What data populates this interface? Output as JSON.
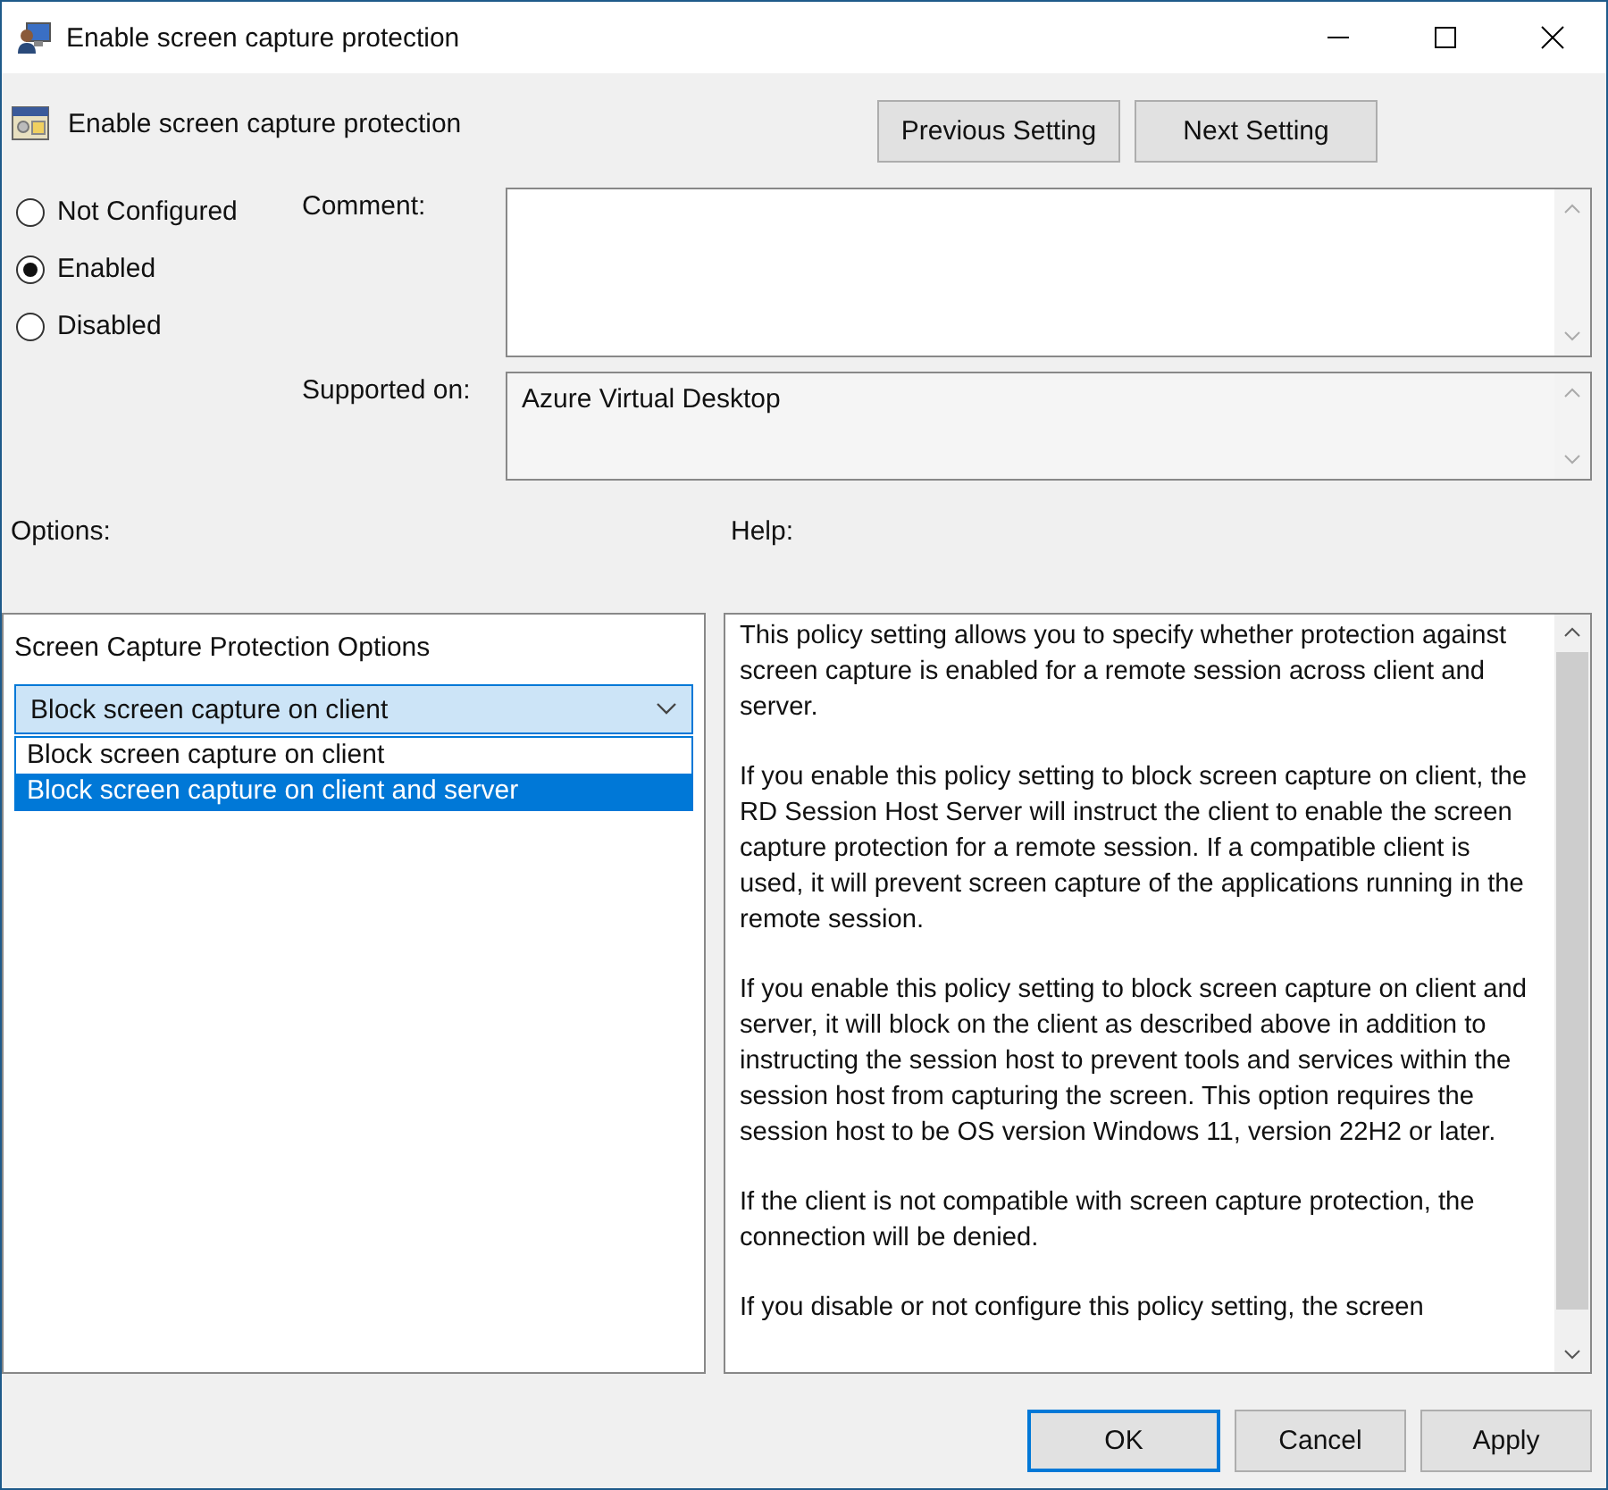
{
  "window": {
    "title": "Enable screen capture protection"
  },
  "setting": {
    "title": "Enable screen capture protection"
  },
  "nav_buttons": [
    "Previous Setting",
    "Next Setting"
  ],
  "state_options": [
    {
      "label": "Not Configured",
      "selected": false
    },
    {
      "label": "Enabled",
      "selected": true
    },
    {
      "label": "Disabled",
      "selected": false
    }
  ],
  "comment": {
    "label": "Comment:"
  },
  "supported_on": {
    "label": "Supported on:",
    "value": "Azure Virtual Desktop"
  },
  "options": {
    "label": "Options:",
    "group_label": "Screen Capture Protection Options",
    "dropdown": {
      "value": "Block screen capture on client",
      "expanded": true,
      "items": [
        {
          "label": "Block screen capture on client",
          "highlighted": false
        },
        {
          "label": "Block screen capture on client and server",
          "highlighted": true
        }
      ]
    }
  },
  "help": {
    "label": "Help:",
    "paragraphs": [
      "This policy setting allows you to specify whether protection against screen capture is enabled for a remote session across client and server.",
      "If you enable this policy setting to block screen capture on client, the RD Session Host Server will instruct the client to enable the screen capture protection for a remote session. If a compatible client is used, it will prevent screen capture of the applications running in the remote session.",
      "If you enable this policy setting to block screen capture on client and server, it will block on the client as described above in addition to instructing the session host to prevent tools and services within the session host from capturing the screen. This option requires the session host to be OS version Windows 11, version 22H2 or later.",
      "If the client is not compatible with screen capture protection, the connection will be denied.",
      "If you disable or not configure this policy setting, the screen"
    ]
  },
  "buttons": [
    {
      "label": "OK",
      "kind": "default"
    },
    {
      "label": "Cancel",
      "kind": "normal"
    },
    {
      "label": "Apply",
      "kind": "normal"
    }
  ]
}
